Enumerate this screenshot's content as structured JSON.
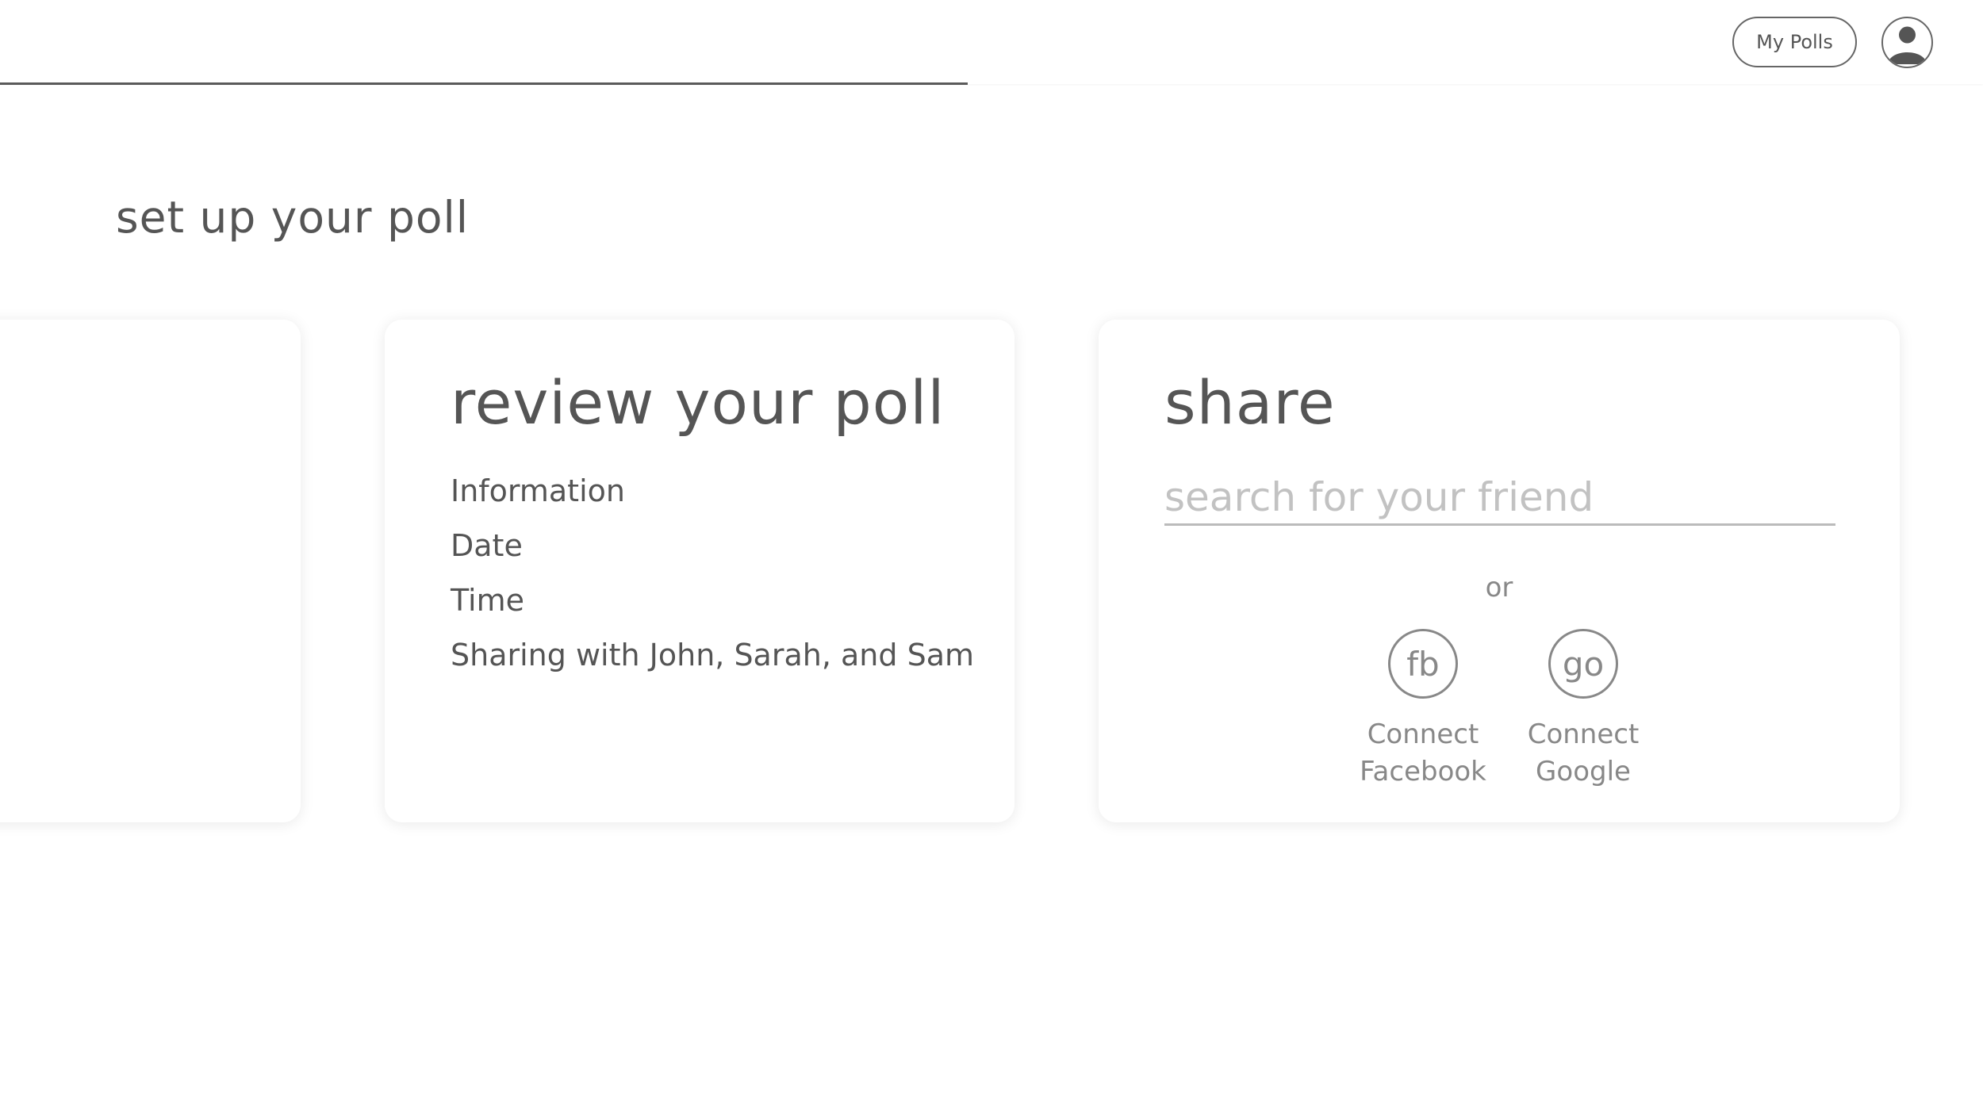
{
  "header": {
    "progress_fraction": 0.488,
    "my_polls_label": "My Polls",
    "avatar_icon": "user-avatar-icon"
  },
  "page": {
    "title": "set up your poll"
  },
  "review_card": {
    "heading": "review your poll",
    "items": [
      "Information",
      "Date",
      "Time",
      "Sharing with John, Sarah, and Sam"
    ]
  },
  "share_card": {
    "heading": "share",
    "search_placeholder": "search for your friend",
    "search_value": "",
    "or_label": "or",
    "connect_facebook": {
      "icon_text": "fb",
      "label": "Connect\nFacebook"
    },
    "connect_google": {
      "icon_text": "go",
      "label": "Connect\nGoogle"
    }
  },
  "colors": {
    "text": "#555555",
    "muted": "#888888",
    "placeholder": "#c2c2c2",
    "progress": "#5a5a5a"
  }
}
